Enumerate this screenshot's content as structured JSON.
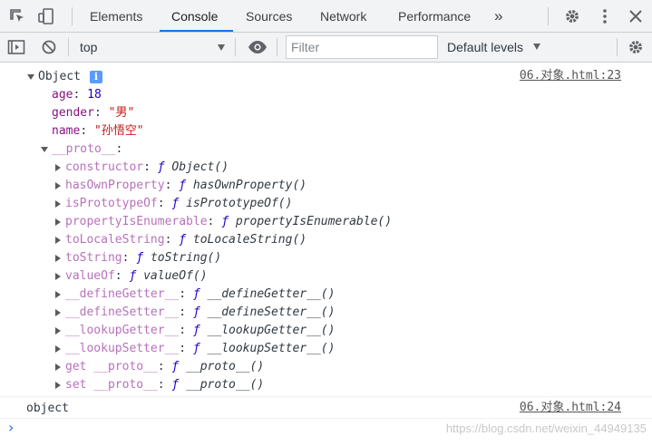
{
  "tabs": {
    "elements": "Elements",
    "console": "Console",
    "sources": "Sources",
    "network": "Network",
    "performance": "Performance",
    "more": "»"
  },
  "toolbar": {
    "context": "top",
    "filter_placeholder": "Filter",
    "levels": "Default levels"
  },
  "console": {
    "entry1": {
      "label": "Object",
      "info_badge": "i",
      "source": "06.对象.html:23",
      "props": [
        {
          "key": "age",
          "value": "18"
        },
        {
          "key": "gender",
          "value": "\"男\""
        },
        {
          "key": "name",
          "value": "\"孙悟空\""
        }
      ],
      "proto_key": "__proto__",
      "proto_items": [
        {
          "key": "constructor",
          "fn": "ƒ",
          "name": "Object()"
        },
        {
          "key": "hasOwnProperty",
          "fn": "ƒ",
          "name": "hasOwnProperty()"
        },
        {
          "key": "isPrototypeOf",
          "fn": "ƒ",
          "name": "isPrototypeOf()"
        },
        {
          "key": "propertyIsEnumerable",
          "fn": "ƒ",
          "name": "propertyIsEnumerable()"
        },
        {
          "key": "toLocaleString",
          "fn": "ƒ",
          "name": "toLocaleString()"
        },
        {
          "key": "toString",
          "fn": "ƒ",
          "name": "toString()"
        },
        {
          "key": "valueOf",
          "fn": "ƒ",
          "name": "valueOf()"
        },
        {
          "key": "__defineGetter__",
          "fn": "ƒ",
          "name": "__defineGetter__()"
        },
        {
          "key": "__defineSetter__",
          "fn": "ƒ",
          "name": "__defineSetter__()"
        },
        {
          "key": "__lookupGetter__",
          "fn": "ƒ",
          "name": "__lookupGetter__()"
        },
        {
          "key": "__lookupSetter__",
          "fn": "ƒ",
          "name": "__lookupSetter__()"
        },
        {
          "key": "get __proto__",
          "fn": "ƒ",
          "name": "__proto__()"
        },
        {
          "key": "set __proto__",
          "fn": "ƒ",
          "name": "__proto__()"
        }
      ]
    },
    "entry2": {
      "text": "object",
      "source": "06.对象.html:24"
    },
    "prompt": "›"
  },
  "watermark": "https://blog.csdn.net/weixin_44949135",
  "colors": {
    "accent": "#1a73e8",
    "key": "#881280",
    "proto_key": "#b871bc",
    "number": "#1c00cf",
    "string": "#c41a16"
  },
  "icons": [
    "inspect-element-icon",
    "device-toolbar-icon",
    "more-tabs-icon",
    "settings-gear-icon",
    "kebab-menu-icon",
    "close-icon",
    "sidebar-toggle-icon",
    "clear-console-icon",
    "eye-icon",
    "settings-gear-icon"
  ]
}
